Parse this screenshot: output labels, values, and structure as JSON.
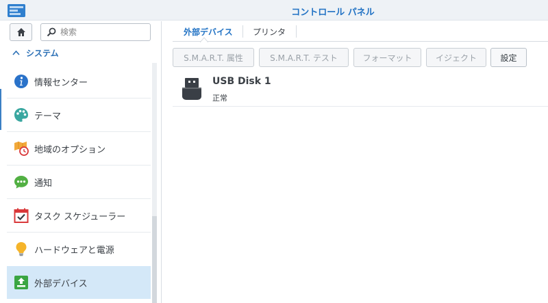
{
  "window": {
    "title": "コントロール パネル"
  },
  "sidebar": {
    "search_placeholder": "検索",
    "section_label": "システム",
    "items": [
      {
        "label": "情報センター",
        "icon": "info-icon"
      },
      {
        "label": "テーマ",
        "icon": "palette-icon"
      },
      {
        "label": "地域のオプション",
        "icon": "map-clock-icon"
      },
      {
        "label": "通知",
        "icon": "chat-bubble-icon"
      },
      {
        "label": "タスク スケジューラー",
        "icon": "calendar-check-icon"
      },
      {
        "label": "ハードウェアと電源",
        "icon": "lightbulb-icon"
      },
      {
        "label": "外部デバイス",
        "icon": "external-device-icon"
      }
    ]
  },
  "tabs": [
    {
      "label": "外部デバイス",
      "active": true
    },
    {
      "label": "プリンタ",
      "active": false
    }
  ],
  "toolbar": {
    "smart_attr": "S.M.A.R.T. 属性",
    "smart_test": "S.M.A.R.T. テスト",
    "format": "フォーマット",
    "eject": "イジェクト",
    "settings": "設定"
  },
  "devices": [
    {
      "name": "USB Disk 1",
      "status": "正常"
    }
  ],
  "colors": {
    "accent": "#2172c4",
    "active_item_bg": "#d4e8f8",
    "section_label": "#2a6fb5"
  }
}
